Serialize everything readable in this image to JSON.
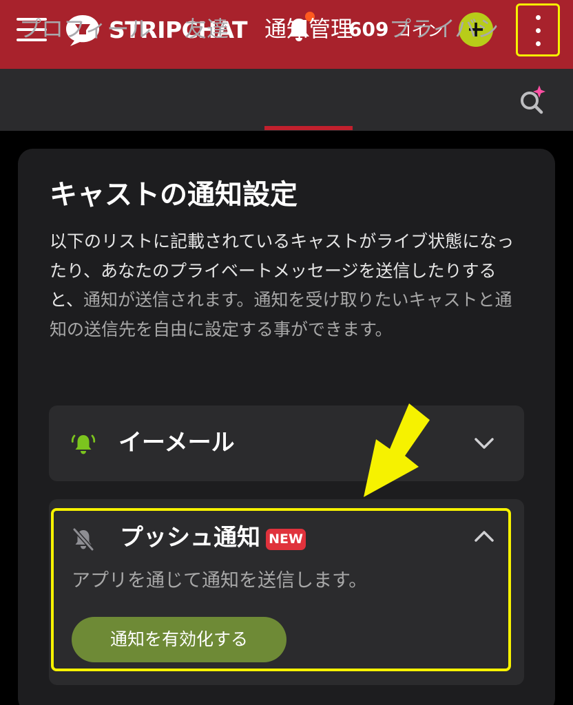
{
  "header": {
    "logo": {
      "text_bold": "STRIP",
      "text_regular": "CHAT",
      "icon": "stripchat-logo-icon"
    },
    "notification_icon": "bell-icon",
    "coins": {
      "amount": "609",
      "unit": "コイン"
    },
    "add_coins_label": "+",
    "menu_icon": "hamburger-menu-icon",
    "more_icon": "vertical-ellipsis-icon"
  },
  "tabs": [
    {
      "label": "プロフィール",
      "active": false
    },
    {
      "label": "友達",
      "active": false
    },
    {
      "label": "通知管理",
      "active": true
    },
    {
      "label": "プライバシ",
      "active": false
    }
  ],
  "tabs_search_icon": "search-sparkle-icon",
  "section": {
    "title": "キャストの通知設定",
    "description_bright": "以下のリストに記載されているキャストがライブ状態になったり、あなたのプライベートメッセージを送信したりすると、",
    "description_dim": "通知が送信されます。通知を受け取りたいキャストと通知の送信先を自由に設定する事ができます。"
  },
  "email_item": {
    "label": "イーメール",
    "icon": "bell-ringing-icon",
    "expanded": false
  },
  "push_item": {
    "label": "プッシュ通知",
    "badge": "NEW",
    "icon": "bell-off-icon",
    "expanded": true,
    "description": "アプリを通じて通知を送信します。",
    "button_label": "通知を有効化する"
  },
  "colors": {
    "header_bg": "#a8222c",
    "tab_active_underline": "#c2202d",
    "plus_button": "#b8cc19",
    "enable_button": "#6e8a36",
    "badge_bg": "#e0323c",
    "highlight": "#f6f200",
    "bell_green": "#7cc41e"
  }
}
